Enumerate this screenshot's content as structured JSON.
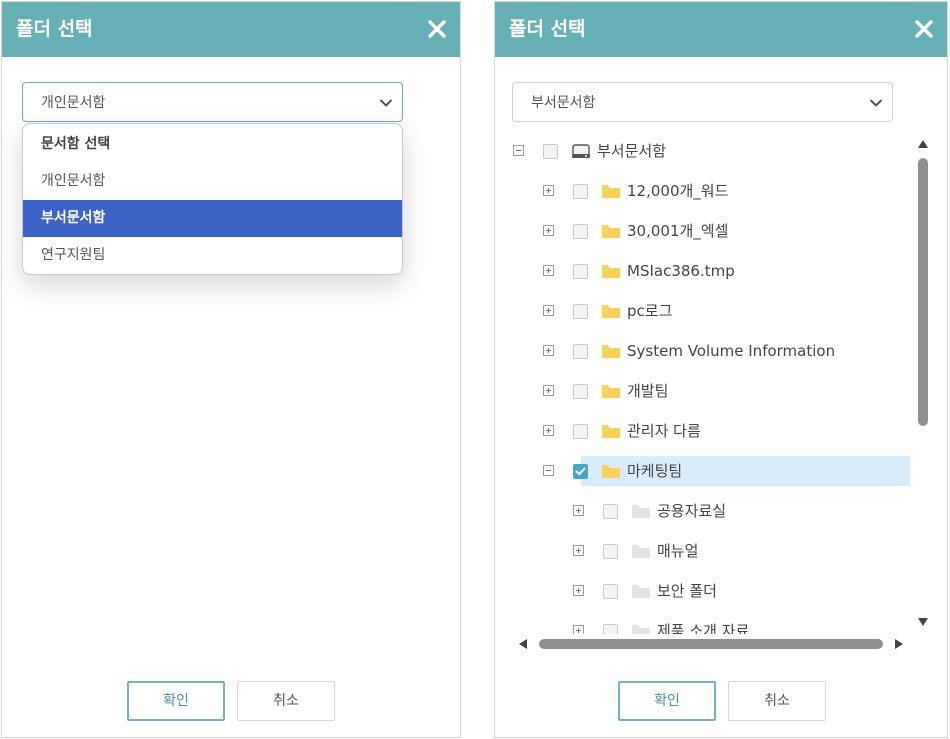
{
  "left_dialog": {
    "title": "폴더 선택",
    "select_value": "개인문서함",
    "options": [
      {
        "label": "문서함 선택"
      },
      {
        "label": "개인문서함"
      },
      {
        "label": "부서문서함",
        "selected": true
      },
      {
        "label": "연구지원팀"
      }
    ],
    "confirm_label": "확인",
    "cancel_label": "취소"
  },
  "right_dialog": {
    "title": "폴더 선택",
    "select_value": "부서문서함",
    "tree": [
      {
        "label": "부서문서함",
        "level": 0,
        "expander": "minus",
        "icon": "drive-icon",
        "checked": false
      },
      {
        "label": "12,000개_워드",
        "level": 1,
        "expander": "plus",
        "icon": "folder-icon",
        "checked": false
      },
      {
        "label": "30,001개_엑셀",
        "level": 1,
        "expander": "plus",
        "icon": "folder-icon",
        "checked": false
      },
      {
        "label": "MSIac386.tmp",
        "level": 1,
        "expander": "plus",
        "icon": "folder-icon",
        "checked": false
      },
      {
        "label": "pc로그",
        "level": 1,
        "expander": "plus",
        "icon": "folder-icon",
        "checked": false
      },
      {
        "label": "System Volume Information",
        "level": 1,
        "expander": "plus",
        "icon": "folder-icon",
        "checked": false
      },
      {
        "label": "개발팀",
        "level": 1,
        "expander": "plus",
        "icon": "folder-icon",
        "checked": false
      },
      {
        "label": "관리자 다름",
        "level": 1,
        "expander": "plus",
        "icon": "folder-icon",
        "checked": false
      },
      {
        "label": "마케팅팀",
        "level": 1,
        "expander": "minus",
        "icon": "folder-icon",
        "checked": true,
        "selected": true
      },
      {
        "label": "공용자료실",
        "level": 2,
        "expander": "plus",
        "icon": "folder-gray-icon",
        "checked": false
      },
      {
        "label": "매뉴얼",
        "level": 2,
        "expander": "plus",
        "icon": "folder-gray-icon",
        "checked": false
      },
      {
        "label": "보안 폴더",
        "level": 2,
        "expander": "plus",
        "icon": "folder-gray-icon",
        "checked": false
      },
      {
        "label": "제품 소개 자료",
        "level": 2,
        "expander": "plus",
        "icon": "folder-gray-icon",
        "checked": false
      }
    ],
    "confirm_label": "확인",
    "cancel_label": "취소"
  },
  "colors": {
    "titlebar": "#66b0b6",
    "dropdown_selected": "#3e63c8",
    "tree_selected_row": "#d9ecfc",
    "folder_yellow": "#f7d15a",
    "folder_gray": "#e3e3e3",
    "checkbox_checked": "#4aa3c8",
    "primary_button_border": "#73b4bd"
  }
}
